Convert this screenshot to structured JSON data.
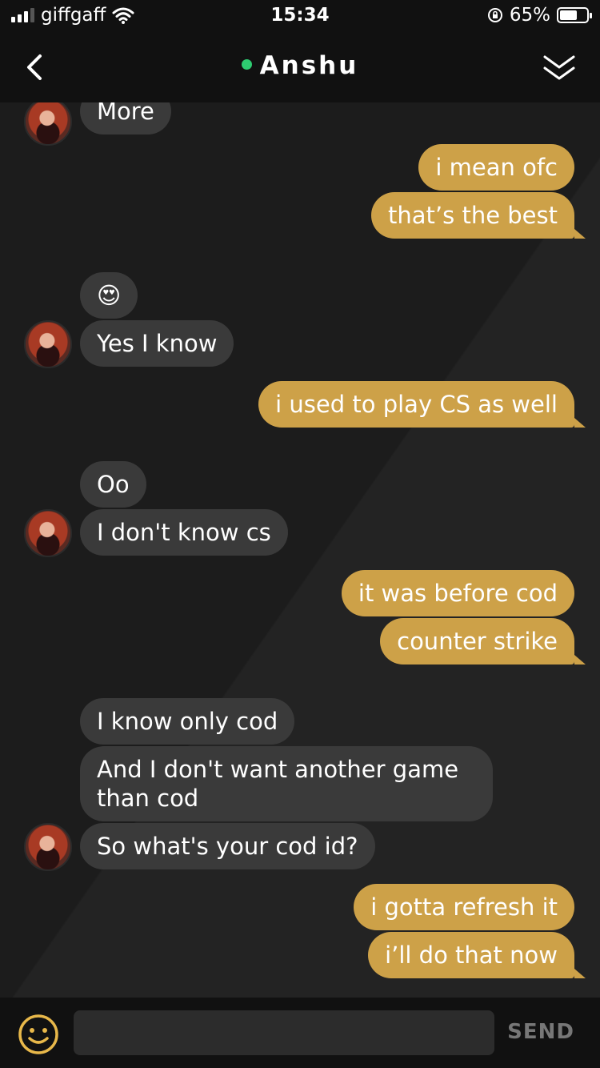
{
  "status_bar": {
    "carrier": "giffgaff",
    "time": "15:34",
    "battery": "65%",
    "battery_level": 0.65
  },
  "header": {
    "contact_name": "Anshu",
    "online_color": "#2ecc71",
    "icons": {
      "back": "chevron-left-icon",
      "collapse": "double-chevron-down-icon"
    }
  },
  "colors": {
    "outgoing": "#cda148",
    "incoming": "#3a3a3a",
    "background": "#1c1c1c",
    "bars": "#111111"
  },
  "messages": [
    {
      "side": "in",
      "text": "More"
    },
    {
      "side": "out",
      "text": "i mean ofc"
    },
    {
      "side": "out",
      "text": "that’s the best"
    },
    {
      "side": "in",
      "text": "😍"
    },
    {
      "side": "in",
      "text": "Yes I know"
    },
    {
      "side": "out",
      "text": "i used to play CS as well"
    },
    {
      "side": "in",
      "text": "Oo"
    },
    {
      "side": "in",
      "text": "I don't know cs"
    },
    {
      "side": "out",
      "text": "it was before cod"
    },
    {
      "side": "out",
      "text": "counter strike"
    },
    {
      "side": "in",
      "text": "I know only cod"
    },
    {
      "side": "in",
      "text": "And I don't want another game than cod"
    },
    {
      "side": "in",
      "text": "So what's your cod id?"
    },
    {
      "side": "out",
      "text": "i gotta refresh it"
    },
    {
      "side": "out",
      "text": "i’ll do that now"
    }
  ],
  "input": {
    "placeholder": "",
    "value": "",
    "send_label": "SEND",
    "emoji_icon": "smiley-icon"
  }
}
